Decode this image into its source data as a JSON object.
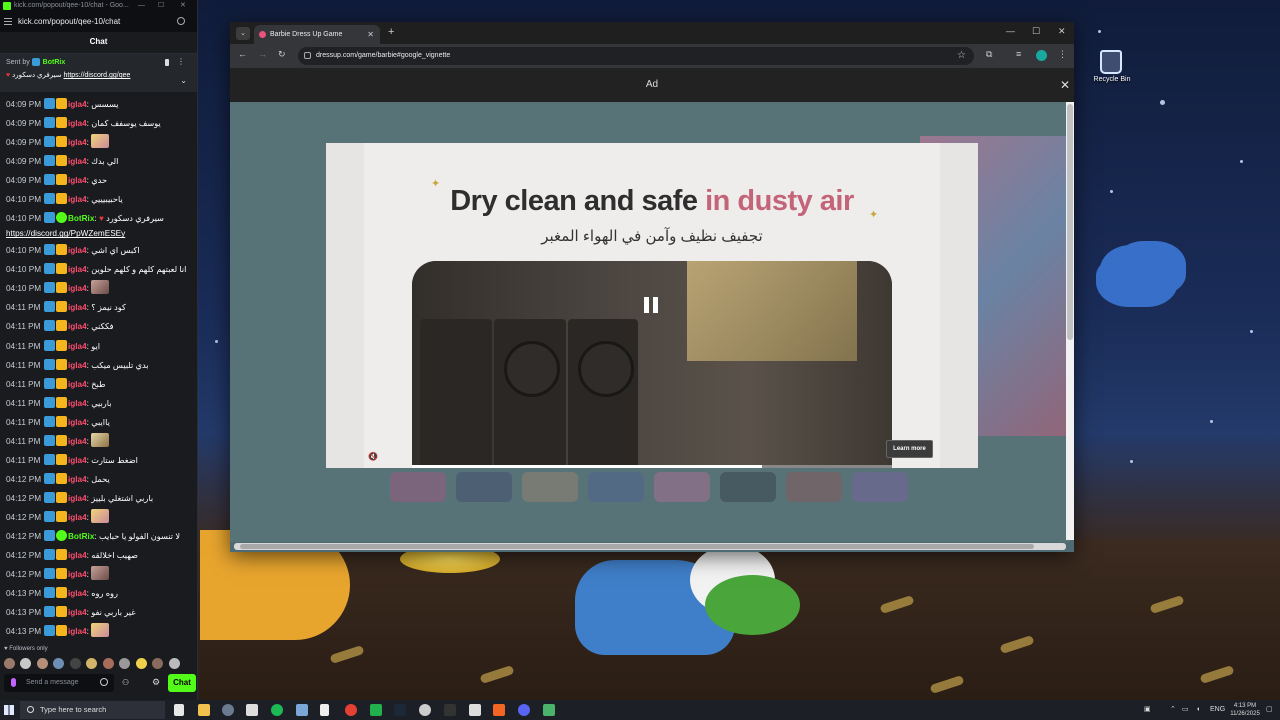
{
  "chat_window": {
    "titlebar": "kick.com/popout/qee-10/chat - Goo...",
    "url": "kick.com/popout/qee-10/chat",
    "header": "Chat",
    "pinned": {
      "sent_by_prefix": "Sent by",
      "sent_by_user": "BotRix",
      "message": "سيرفري دسكورد",
      "link": "https://discord.gg/qee"
    },
    "messages": [
      {
        "time": "04:09 PM",
        "user": "igla4",
        "text": "يسسس",
        "emote": ""
      },
      {
        "time": "04:09 PM",
        "user": "igla4",
        "text": "يوسف يوسفف كمان",
        "emote": ""
      },
      {
        "time": "04:09 PM",
        "user": "igla4",
        "text": "",
        "emote": "emote-1"
      },
      {
        "time": "04:09 PM",
        "user": "igla4",
        "text": "الي بدك",
        "emote": ""
      },
      {
        "time": "04:09 PM",
        "user": "igla4",
        "text": "حدي",
        "emote": ""
      },
      {
        "time": "04:10 PM",
        "user": "igla4",
        "text": "ياحبيبيييي",
        "emote": ""
      },
      {
        "time": "04:10 PM",
        "user": "BotRix",
        "text": "سيرفري دسكورد",
        "emote": "",
        "link": "https://discord.gg/PpWZemESEy"
      },
      {
        "time": "04:10 PM",
        "user": "igla4",
        "text": "اكبس اي اشي",
        "emote": ""
      },
      {
        "time": "04:10 PM",
        "user": "igla4",
        "text": "انا لعبتهم كلهم و كلهم حلوين",
        "emote": ""
      },
      {
        "time": "04:10 PM",
        "user": "igla4",
        "text": "",
        "emote": "emote-2"
      },
      {
        "time": "04:11 PM",
        "user": "igla4",
        "text": "كود نيمز ؟",
        "emote": ""
      },
      {
        "time": "04:11 PM",
        "user": "igla4",
        "text": "فككني",
        "emote": ""
      },
      {
        "time": "04:11 PM",
        "user": "igla4",
        "text": "ايو",
        "emote": ""
      },
      {
        "time": "04:11 PM",
        "user": "igla4",
        "text": "بدي تلبيس ميكب",
        "emote": ""
      },
      {
        "time": "04:11 PM",
        "user": "igla4",
        "text": "طبخ",
        "emote": ""
      },
      {
        "time": "04:11 PM",
        "user": "igla4",
        "text": "باربيي",
        "emote": ""
      },
      {
        "time": "04:11 PM",
        "user": "igla4",
        "text": "ياايبي",
        "emote": ""
      },
      {
        "time": "04:11 PM",
        "user": "igla4",
        "text": "",
        "emote": "emote-3"
      },
      {
        "time": "04:11 PM",
        "user": "igla4",
        "text": "اضغط ستارت",
        "emote": ""
      },
      {
        "time": "04:12 PM",
        "user": "igla4",
        "text": "يحمل",
        "emote": ""
      },
      {
        "time": "04:12 PM",
        "user": "igla4",
        "text": "باربي اشتغلي بلييز",
        "emote": ""
      },
      {
        "time": "04:12 PM",
        "user": "igla4",
        "text": "",
        "emote": "emote-1"
      },
      {
        "time": "04:12 PM",
        "user": "BotRix",
        "text": "لا تنسون الفولو يا حبايب",
        "emote": ""
      },
      {
        "time": "04:12 PM",
        "user": "igla4",
        "text": "صهيب اخلالقه",
        "emote": ""
      },
      {
        "time": "04:12 PM",
        "user": "igla4",
        "text": "",
        "emote": "emote-2"
      },
      {
        "time": "04:13 PM",
        "user": "igla4",
        "text": "روه روه",
        "emote": ""
      },
      {
        "time": "04:13 PM",
        "user": "igla4",
        "text": "غير باربي نفو",
        "emote": ""
      },
      {
        "time": "04:13 PM",
        "user": "igla4",
        "text": "",
        "emote": "emote-1"
      }
    ],
    "followers_only": "Followers only",
    "send_placeholder": "Send a message",
    "chat_button": "Chat"
  },
  "browser": {
    "tab_title": "Barbie Dress Up Game",
    "url": "dressup.com/game/barbie#google_vignette",
    "ad_label": "Ad",
    "ad": {
      "headline_main": "Dry clean and safe ",
      "headline_accent": "in dusty air",
      "headline_ar": "تجفيف نظيف وآمن في الهواء المغبر",
      "learn_more": "Learn more",
      "progress": 0.73
    }
  },
  "desktop": {
    "recycle_bin": "Recycle Bin"
  },
  "taskbar": {
    "search_placeholder": "Type here to search",
    "language": "ENG",
    "time": "4:13 PM",
    "date": "11/26/2025"
  },
  "colors": {
    "kick_green": "#53fc18",
    "username_red": "#ff4d6d",
    "ad_accent": "#c46478"
  }
}
